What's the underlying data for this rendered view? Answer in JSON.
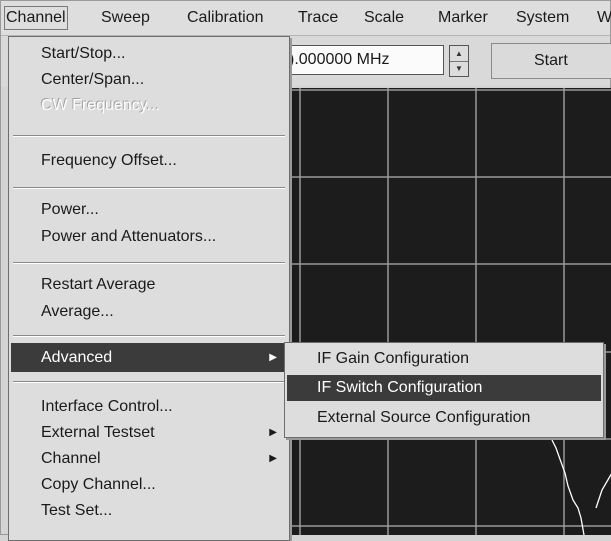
{
  "menubar": {
    "items": [
      "Channel",
      "Sweep",
      "Calibration",
      "Trace",
      "Scale",
      "Marker",
      "System",
      "W"
    ]
  },
  "toolbar": {
    "frequency_value": ").000000 MHz",
    "start_label": "Start"
  },
  "channel_menu": {
    "items": [
      {
        "label": "Start/Stop..."
      },
      {
        "label": "Center/Span..."
      },
      {
        "label": "CW Frequency...",
        "disabled": true
      },
      {
        "label": "Frequency Offset..."
      },
      {
        "label": "Power..."
      },
      {
        "label": "Power and Attenuators..."
      },
      {
        "label": "Restart Average"
      },
      {
        "label": "Average..."
      },
      {
        "label": "Advanced",
        "submenu": true,
        "selected": true
      },
      {
        "label": "Interface Control..."
      },
      {
        "label": "External Testset",
        "submenu": true
      },
      {
        "label": "Channel",
        "submenu": true
      },
      {
        "label": "Copy Channel..."
      },
      {
        "label": "Test Set..."
      }
    ]
  },
  "advanced_submenu": {
    "items": [
      {
        "label": "IF Gain Configuration"
      },
      {
        "label": "IF Switch Configuration",
        "selected": true
      },
      {
        "label": "External Source Configuration"
      }
    ]
  },
  "icons": {
    "submenu_arrow": "right-triangle-icon",
    "spinner_up": "up-triangle-icon",
    "spinner_down": "down-triangle-icon"
  },
  "colors": {
    "menu_bg": "#dddddd",
    "highlight": "#3b3b3b",
    "plot_bg": "#1c1c1c",
    "grid": "#9a9a9a",
    "trace": "#ffffff"
  }
}
